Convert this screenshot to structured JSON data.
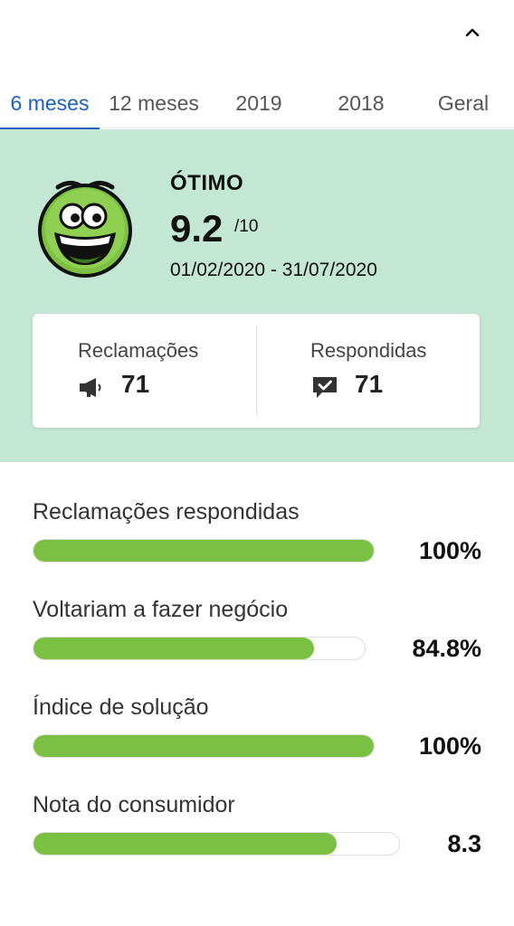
{
  "header": {
    "collapse_icon": "chevron-up-icon"
  },
  "tabs": [
    {
      "label": "6 meses",
      "active": true
    },
    {
      "label": "12 meses",
      "active": false
    },
    {
      "label": "2019",
      "active": false
    },
    {
      "label": "2018",
      "active": false
    },
    {
      "label": "Geral",
      "active": false
    }
  ],
  "summary": {
    "background_color": "#c4e7d5",
    "rating_label": "ÓTIMO",
    "score": "9.2",
    "score_max": "/10",
    "period": "01/02/2020 - 31/07/2020",
    "face_icon": "smiley-face-icon",
    "stats": {
      "complaints": {
        "label": "Reclamações",
        "value": "71",
        "icon": "megaphone-icon"
      },
      "answered": {
        "label": "Respondidas",
        "value": "71",
        "icon": "chat-check-icon"
      }
    }
  },
  "metrics": [
    {
      "label": "Reclamações respondidas",
      "value": "100%",
      "fill": 1.0
    },
    {
      "label": "Voltariam a fazer negócio",
      "value": "84.8%",
      "fill": 0.848
    },
    {
      "label": "Índice de solução",
      "value": "100%",
      "fill": 1.0
    },
    {
      "label": "Nota do consumidor",
      "value": "8.3",
      "fill": 0.83
    }
  ],
  "colors": {
    "accent": "#1f5fbf",
    "bar_fill": "#7ac143",
    "summary_bg": "#c4e7d5"
  }
}
